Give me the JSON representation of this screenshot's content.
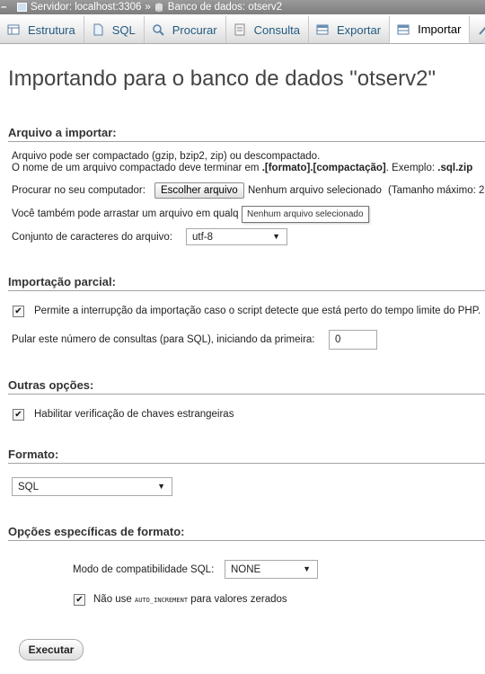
{
  "breadcrumb": {
    "server": "Servidor: localhost:3306",
    "separator": "»",
    "database": "Banco de dados: otserv2"
  },
  "tabs": [
    {
      "label": "Estrutura",
      "icon": "structure-icon"
    },
    {
      "label": "SQL",
      "icon": "sql-icon"
    },
    {
      "label": "Procurar",
      "icon": "search-icon"
    },
    {
      "label": "Consulta",
      "icon": "query-icon"
    },
    {
      "label": "Exportar",
      "icon": "export-icon"
    },
    {
      "label": "Importar",
      "icon": "import-icon",
      "active": true
    }
  ],
  "page_title": "Importando para o banco de dados \"otserv2\"",
  "file_section": {
    "title": "Arquivo a importar:",
    "line1": "Arquivo pode ser compactado (gzip, bzip2, zip) ou descompactado.",
    "line2_prefix": "O nome de um arquivo compactado deve terminar em ",
    "line2_format": ".[formato].[compactação]",
    "line2_middle": ". Exemplo: ",
    "line2_example": ".sql.zip",
    "browse_label": "Procurar no seu computador:",
    "choose_button": "Escolher arquivo",
    "no_file": "Nenhum arquivo selecionado",
    "max_size": "(Tamanho máximo: 2",
    "drag_text": "Você também pode arrastar um arquivo em qualq",
    "tooltip": "Nenhum arquivo selecionado",
    "charset_label": "Conjunto de caracteres do arquivo:",
    "charset_value": "utf-8"
  },
  "partial_section": {
    "title": "Importação parcial:",
    "allow_interrupt": "Permite a interrupção da importação caso o script detecte que está perto do tempo limite do PHP.",
    "skip_label": "Pular este número de consultas (para SQL), iniciando da primeira:",
    "skip_value": "0"
  },
  "other_section": {
    "title": "Outras opções:",
    "foreign_keys": "Habilitar verificação de chaves estrangeiras"
  },
  "format_section": {
    "title": "Formato:",
    "value": "SQL"
  },
  "format_options": {
    "title": "Opções específicas de formato:",
    "compat_label": "Modo de compatibilidade SQL:",
    "compat_value": "NONE",
    "auto_inc_prefix": "Não use ",
    "auto_inc_code": "AUTO_INCREMENT",
    "auto_inc_suffix": " para valores zerados"
  },
  "execute_button": "Executar",
  "colors": {
    "tab_text": "#235a81",
    "breadcrumb_bg": "#8a8a8a"
  }
}
